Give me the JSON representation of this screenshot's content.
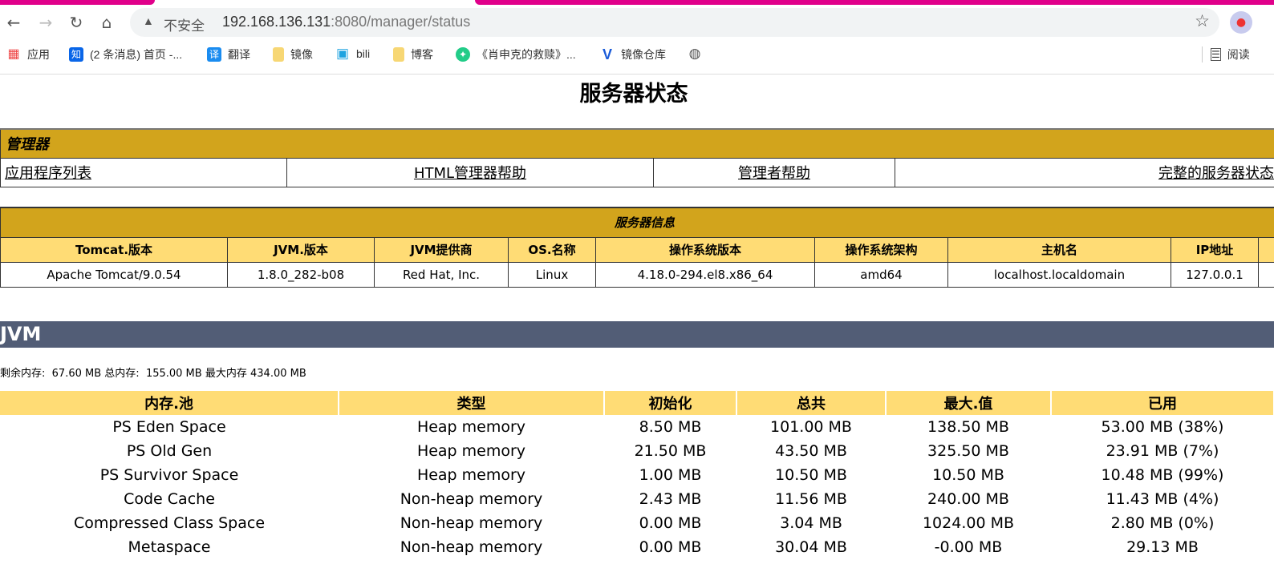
{
  "browser": {
    "security": "不安全",
    "url_host": "192.168.136.131",
    "url_rest": ":8080/manager/status",
    "bookmarks": [
      {
        "icon": "apps-icon",
        "label": "应用"
      },
      {
        "icon": "zhihu-icon",
        "label": "(2 条消息) 首页 -..."
      },
      {
        "icon": "translate-icon",
        "label": "翻译"
      },
      {
        "icon": "folder-icon",
        "label": "镜像"
      },
      {
        "icon": "bilibili-icon",
        "label": "bili"
      },
      {
        "icon": "folder-icon",
        "label": "博客"
      },
      {
        "icon": "kangaroo-icon",
        "label": "《肖申克的救赎》..."
      },
      {
        "icon": "v-icon",
        "label": "镜像仓库"
      },
      {
        "icon": "globe-icon",
        "label": ""
      }
    ],
    "reading_list": "阅读"
  },
  "page": {
    "title": "服务器状态"
  },
  "manager": {
    "title": "管理器",
    "links": [
      "应用程序列表",
      "HTML管理器帮助",
      "管理者帮助",
      "完整的服务器状态"
    ]
  },
  "server_info": {
    "title": "服务器信息",
    "headers": [
      "Tomcat.版本",
      "JVM.版本",
      "JVM提供商",
      "OS.名称",
      "操作系统版本",
      "操作系统架构",
      "主机名",
      "IP地址"
    ],
    "values": [
      "Apache Tomcat/9.0.54",
      "1.8.0_282-b08",
      "Red Hat, Inc.",
      "Linux",
      "4.18.0-294.el8.x86_64",
      "amd64",
      "localhost.localdomain",
      "127.0.0.1"
    ]
  },
  "jvm": {
    "title": "JVM",
    "free_label": "剩余内存:",
    "free": "67.60 MB",
    "total_label": "总内存:",
    "total": "155.00 MB",
    "max_label": "最大内存",
    "max": "434.00 MB",
    "headers": [
      "内存.池",
      "类型",
      "初始化",
      "总共",
      "最大.值",
      "已用"
    ],
    "rows": [
      [
        "PS Eden Space",
        "Heap memory",
        "8.50 MB",
        "101.00 MB",
        "138.50 MB",
        "53.00 MB (38%)"
      ],
      [
        "PS Old Gen",
        "Heap memory",
        "21.50 MB",
        "43.50 MB",
        "325.50 MB",
        "23.91 MB (7%)"
      ],
      [
        "PS Survivor Space",
        "Heap memory",
        "1.00 MB",
        "10.50 MB",
        "10.50 MB",
        "10.48 MB (99%)"
      ],
      [
        "Code Cache",
        "Non-heap memory",
        "2.43 MB",
        "11.56 MB",
        "240.00 MB",
        "11.43 MB (4%)"
      ],
      [
        "Compressed Class Space",
        "Non-heap memory",
        "0.00 MB",
        "3.04 MB",
        "1024.00 MB",
        "2.80 MB (0%)"
      ],
      [
        "Metaspace",
        "Non-heap memory",
        "0.00 MB",
        "30.04 MB",
        "-0.00 MB",
        "29.13 MB"
      ]
    ]
  }
}
